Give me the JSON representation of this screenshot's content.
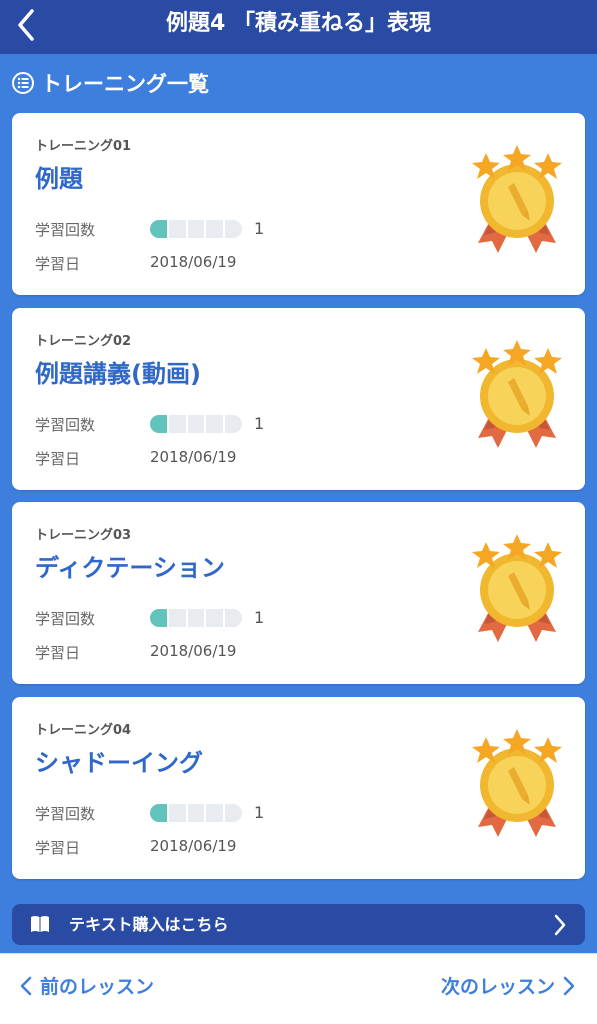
{
  "header": {
    "title": "例題4 「積み重ねる」表現",
    "back_icon": "chevron-left-icon"
  },
  "section": {
    "title": "トレーニング一覧",
    "icon": "list-icon"
  },
  "labels": {
    "count": "学習回数",
    "date": "学習日"
  },
  "cards": [
    {
      "number": "トレーニング01",
      "title": "例題",
      "count": "1",
      "progress": 0.2,
      "date": "2018/06/19",
      "medal": "gold-medal-icon"
    },
    {
      "number": "トレーニング02",
      "title": "例題講義(動画)",
      "count": "1",
      "progress": 0.2,
      "date": "2018/06/19",
      "medal": "gold-medal-icon"
    },
    {
      "number": "トレーニング03",
      "title": "ディクテーション",
      "count": "1",
      "progress": 0.2,
      "date": "2018/06/19",
      "medal": "gold-medal-icon"
    },
    {
      "number": "トレーニング04",
      "title": "シャドーイング",
      "count": "1",
      "progress": 0.2,
      "date": "2018/06/19",
      "medal": "gold-medal-icon"
    }
  ],
  "buy_banner": {
    "text": "テキスト購入はこちら",
    "icon": "book-icon"
  },
  "footer": {
    "prev": "前のレッスン",
    "next": "次のレッスン"
  },
  "colors": {
    "header": "#2a4ba4",
    "background": "#3e7fde",
    "accent": "#2f68c8",
    "progress": "#62c3bd"
  }
}
